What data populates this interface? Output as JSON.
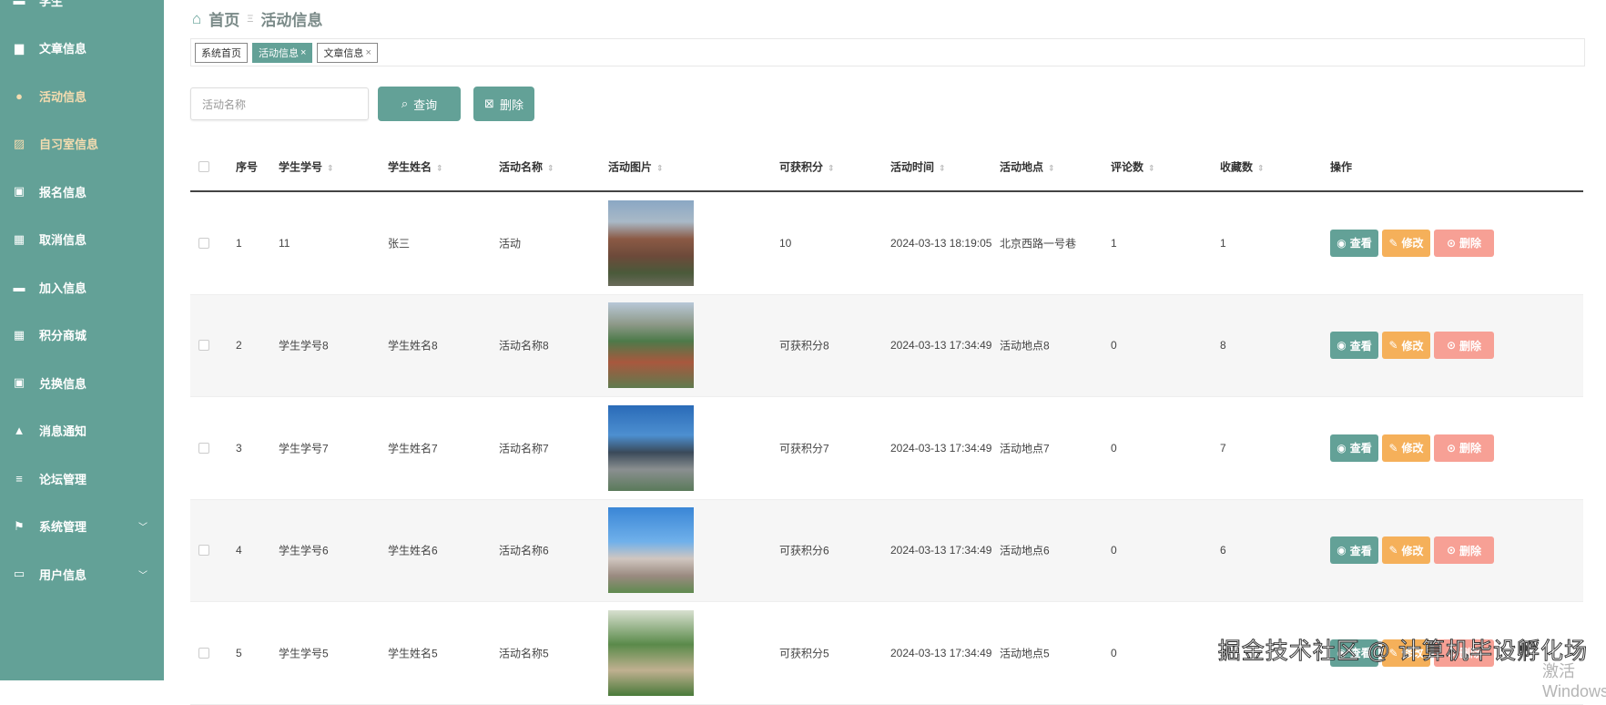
{
  "sidebar": {
    "items": [
      {
        "label": "学生",
        "icon": "user-icon"
      },
      {
        "label": "文章信息",
        "icon": "book-icon"
      },
      {
        "label": "活动信息",
        "icon": "bulb-icon"
      },
      {
        "label": "自习室信息",
        "icon": "chart-icon"
      },
      {
        "label": "报名信息",
        "icon": "clipboard-check-icon"
      },
      {
        "label": "取消信息",
        "icon": "grid-icon"
      },
      {
        "label": "加入信息",
        "icon": "monitor-icon"
      },
      {
        "label": "积分商城",
        "icon": "grid-icon"
      },
      {
        "label": "兑换信息",
        "icon": "clipboard-x-icon"
      },
      {
        "label": "消息通知",
        "icon": "person-icon"
      },
      {
        "label": "论坛管理",
        "icon": "sliders-icon"
      },
      {
        "label": "系统管理",
        "icon": "flag-icon"
      },
      {
        "label": "用户信息",
        "icon": "wallet-icon"
      }
    ]
  },
  "breadcrumb": {
    "home": "首页",
    "current": "活动信息"
  },
  "tabs": [
    {
      "label": "系统首页"
    },
    {
      "label": "活动信息",
      "close": "×"
    },
    {
      "label": "文章信息",
      "close": "×"
    }
  ],
  "search": {
    "placeholder": "活动名称",
    "query_label": "查询",
    "delete_label": "删除"
  },
  "table": {
    "headers": [
      "序号",
      "学生学号",
      "学生姓名",
      "活动名称",
      "活动图片",
      "可获积分",
      "活动时间",
      "活动地点",
      "评论数",
      "收藏数",
      "操作"
    ],
    "actions": {
      "view": "查看",
      "edit": "修改",
      "delete": "删除"
    },
    "rows": [
      [
        "1",
        "11",
        "张三",
        "活动",
        "",
        "10",
        "2024-03-13 18:19:05",
        "北京西路一号巷",
        "1",
        "1"
      ],
      [
        "2",
        "学生学号8",
        "学生姓名8",
        "活动名称8",
        "",
        "可获积分8",
        "2024-03-13 17:34:49",
        "活动地点8",
        "0",
        "8"
      ],
      [
        "3",
        "学生学号7",
        "学生姓名7",
        "活动名称7",
        "",
        "可获积分7",
        "2024-03-13 17:34:49",
        "活动地点7",
        "0",
        "7"
      ],
      [
        "4",
        "学生学号6",
        "学生姓名6",
        "活动名称6",
        "",
        "可获积分6",
        "2024-03-13 17:34:49",
        "活动地点6",
        "0",
        "6"
      ],
      [
        "5",
        "学生学号5",
        "学生姓名5",
        "活动名称5",
        "",
        "可获积分5",
        "2024-03-13 17:34:49",
        "活动地点5",
        "0",
        "5"
      ]
    ]
  },
  "watermark": "掘金技术社区 @ 计算机毕设孵化场",
  "os_notice": "激活 Windows",
  "colors": {
    "primary": "#63a197",
    "edit": "#f5b05a",
    "delete": "#f7a095",
    "active_menu": "#f5dcb0"
  }
}
